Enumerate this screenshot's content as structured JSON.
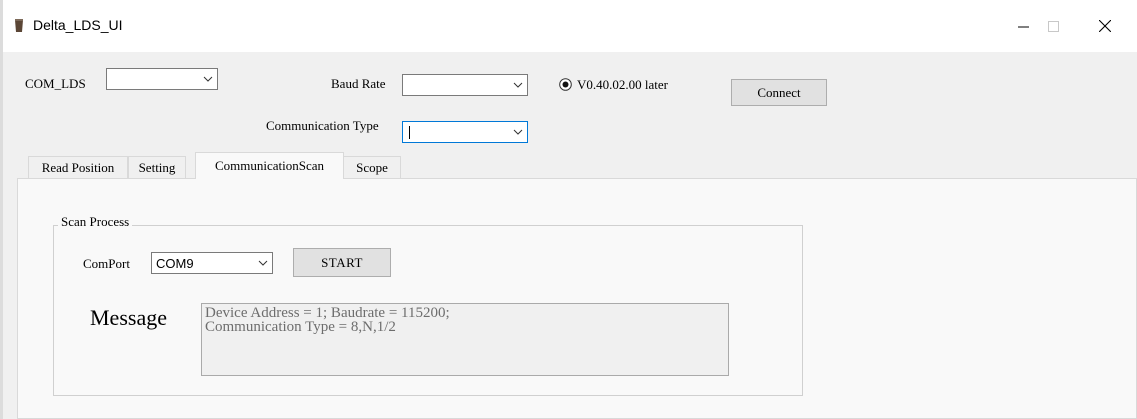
{
  "window": {
    "title": "Delta_LDS_UI",
    "minimize_glyph": "─",
    "maximize_glyph": "☐",
    "close_glyph": "✕"
  },
  "connection": {
    "com_label": "COM_LDS",
    "com_value": "",
    "baud_label": "Baud Rate",
    "baud_value": "",
    "comm_type_label": "Communication Type",
    "comm_type_value": "",
    "version_option": "V0.40.02.00 later",
    "version_selected": true,
    "connect_label": "Connect"
  },
  "tabs": [
    {
      "label": "Read Position",
      "active": false
    },
    {
      "label": "Setting",
      "active": false
    },
    {
      "label": "CommunicationScan",
      "active": true
    },
    {
      "label": "Scope",
      "active": false
    }
  ],
  "scan": {
    "group_title": "Scan Process",
    "comport_label": "ComPort",
    "comport_value": "COM9",
    "start_label": "START",
    "message_label": "Message",
    "message_lines": [
      "Device Address = 1; Baudrate = 115200;",
      "Communication Type = 8,N,1/2"
    ]
  },
  "colors": {
    "accent": "#0078d7",
    "client_bg": "#f0f0f0",
    "tabpage_bg": "#f9f9f9"
  }
}
